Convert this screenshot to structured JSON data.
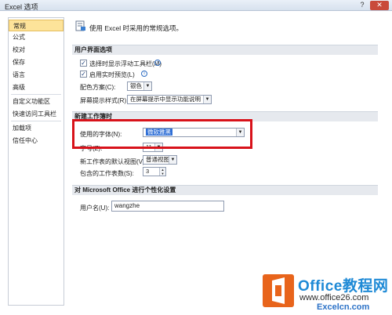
{
  "window": {
    "title": "Excel 选项",
    "help_glyph": "?",
    "close_glyph": "✕"
  },
  "sidebar": {
    "items": [
      {
        "label": "常规",
        "active": true
      },
      {
        "label": "公式"
      },
      {
        "label": "校对"
      },
      {
        "label": "保存"
      },
      {
        "label": "语言"
      },
      {
        "label": "高级"
      },
      {
        "label": "自定义功能区"
      },
      {
        "label": "快速访问工具栏"
      },
      {
        "label": "加载项"
      },
      {
        "label": "信任中心"
      }
    ]
  },
  "content": {
    "heading": "使用 Excel 时采用的常规选项。",
    "sections": {
      "ui": "用户界面选项",
      "new_workbook": "新建工作簿时",
      "personalize": "对 Microsoft Office 进行个性化设置"
    },
    "ui": {
      "show_minitoolbar": "选择时显示浮动工具栏(M)",
      "live_preview": "启用实时预览(L)",
      "color_scheme_label": "配色方案(C):",
      "color_scheme_value": "银色",
      "screentip_label": "屏幕提示样式(R):",
      "screentip_value": "在屏幕提示中显示功能说明"
    },
    "new_workbook": {
      "font_label": "使用的字体(N):",
      "font_value": "微软雅黑",
      "size_label": "字号(Z):",
      "size_value": "11",
      "view_label": "新工作表的默认视图(V):",
      "view_value": "普通视图",
      "sheets_label": "包含的工作表数(S):",
      "sheets_value": "3"
    },
    "personalize": {
      "username_label": "用户名(U):",
      "username_value": "wangzhe"
    }
  },
  "watermark": {
    "brand": "Office教程网",
    "url": "www.office26.com",
    "site": "Excelcn.com"
  },
  "colors": {
    "highlight": "#d8121a",
    "active_item": "#fde39a",
    "logo": "#e8641b"
  }
}
